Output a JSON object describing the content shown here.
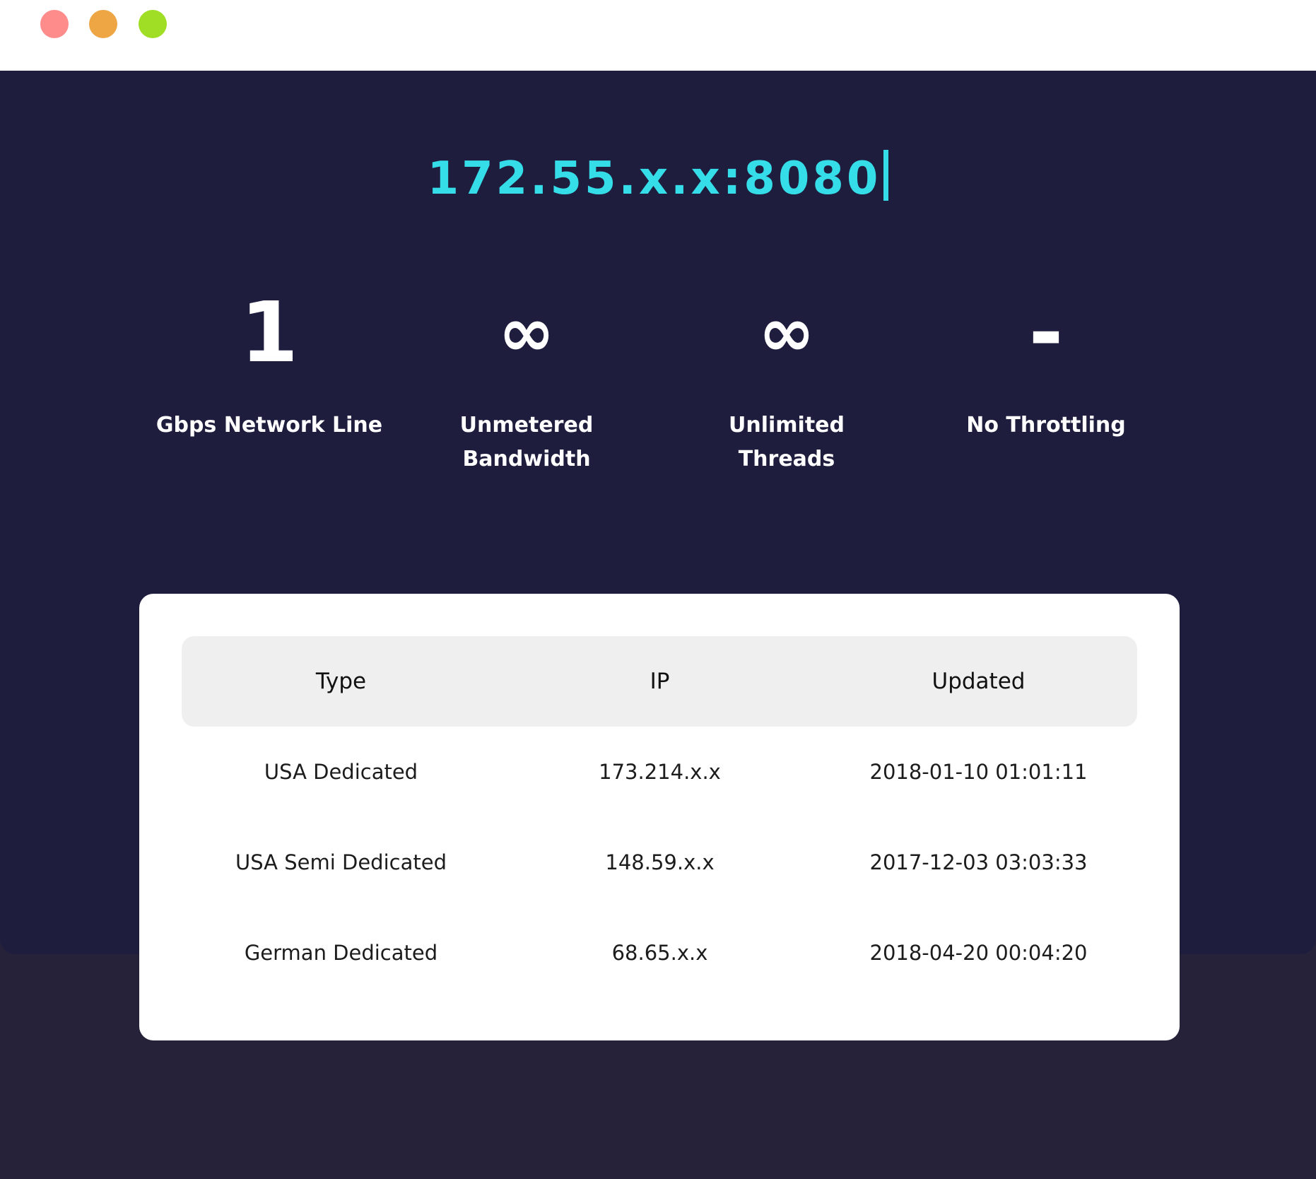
{
  "window": {
    "controls": {
      "close_color": "#fd8c8b",
      "minimize_color": "#eea645",
      "maximize_color": "#a0dd25"
    }
  },
  "hero": {
    "address": "172.55.x.x:8080",
    "address_color": "#35dde8",
    "background": "#1f1d3e"
  },
  "stats": [
    {
      "value": "1",
      "label": "Gbps Network Line"
    },
    {
      "value": "∞",
      "label": "Unmetered\nBandwidth"
    },
    {
      "value": "∞",
      "label": "Unlimited\nThreads"
    },
    {
      "value": "-",
      "label": "No Throttling"
    }
  ],
  "table": {
    "headers": [
      "Type",
      "IP",
      "Updated"
    ],
    "rows": [
      [
        "USA Dedicated",
        "173.214.x.x",
        "2018-01-10 01:01:11"
      ],
      [
        "USA Semi Dedicated",
        "148.59.x.x",
        "2017-12-03 03:03:33"
      ],
      [
        "German Dedicated",
        "68.65.x.x",
        "2018-04-20 00:04:20"
      ]
    ]
  }
}
